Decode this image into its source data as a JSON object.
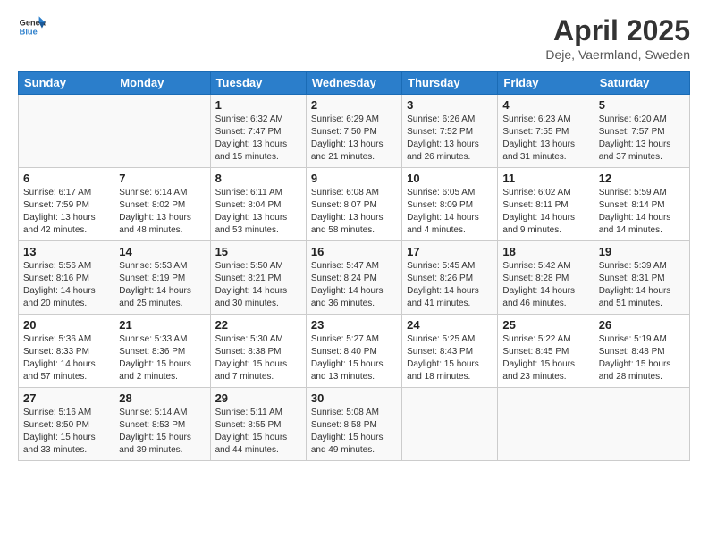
{
  "header": {
    "logo_line1": "General",
    "logo_line2": "Blue",
    "month_title": "April 2025",
    "location": "Deje, Vaermland, Sweden"
  },
  "weekdays": [
    "Sunday",
    "Monday",
    "Tuesday",
    "Wednesday",
    "Thursday",
    "Friday",
    "Saturday"
  ],
  "weeks": [
    [
      {
        "day": "",
        "info": ""
      },
      {
        "day": "",
        "info": ""
      },
      {
        "day": "1",
        "info": "Sunrise: 6:32 AM\nSunset: 7:47 PM\nDaylight: 13 hours and 15 minutes."
      },
      {
        "day": "2",
        "info": "Sunrise: 6:29 AM\nSunset: 7:50 PM\nDaylight: 13 hours and 21 minutes."
      },
      {
        "day": "3",
        "info": "Sunrise: 6:26 AM\nSunset: 7:52 PM\nDaylight: 13 hours and 26 minutes."
      },
      {
        "day": "4",
        "info": "Sunrise: 6:23 AM\nSunset: 7:55 PM\nDaylight: 13 hours and 31 minutes."
      },
      {
        "day": "5",
        "info": "Sunrise: 6:20 AM\nSunset: 7:57 PM\nDaylight: 13 hours and 37 minutes."
      }
    ],
    [
      {
        "day": "6",
        "info": "Sunrise: 6:17 AM\nSunset: 7:59 PM\nDaylight: 13 hours and 42 minutes."
      },
      {
        "day": "7",
        "info": "Sunrise: 6:14 AM\nSunset: 8:02 PM\nDaylight: 13 hours and 48 minutes."
      },
      {
        "day": "8",
        "info": "Sunrise: 6:11 AM\nSunset: 8:04 PM\nDaylight: 13 hours and 53 minutes."
      },
      {
        "day": "9",
        "info": "Sunrise: 6:08 AM\nSunset: 8:07 PM\nDaylight: 13 hours and 58 minutes."
      },
      {
        "day": "10",
        "info": "Sunrise: 6:05 AM\nSunset: 8:09 PM\nDaylight: 14 hours and 4 minutes."
      },
      {
        "day": "11",
        "info": "Sunrise: 6:02 AM\nSunset: 8:11 PM\nDaylight: 14 hours and 9 minutes."
      },
      {
        "day": "12",
        "info": "Sunrise: 5:59 AM\nSunset: 8:14 PM\nDaylight: 14 hours and 14 minutes."
      }
    ],
    [
      {
        "day": "13",
        "info": "Sunrise: 5:56 AM\nSunset: 8:16 PM\nDaylight: 14 hours and 20 minutes."
      },
      {
        "day": "14",
        "info": "Sunrise: 5:53 AM\nSunset: 8:19 PM\nDaylight: 14 hours and 25 minutes."
      },
      {
        "day": "15",
        "info": "Sunrise: 5:50 AM\nSunset: 8:21 PM\nDaylight: 14 hours and 30 minutes."
      },
      {
        "day": "16",
        "info": "Sunrise: 5:47 AM\nSunset: 8:24 PM\nDaylight: 14 hours and 36 minutes."
      },
      {
        "day": "17",
        "info": "Sunrise: 5:45 AM\nSunset: 8:26 PM\nDaylight: 14 hours and 41 minutes."
      },
      {
        "day": "18",
        "info": "Sunrise: 5:42 AM\nSunset: 8:28 PM\nDaylight: 14 hours and 46 minutes."
      },
      {
        "day": "19",
        "info": "Sunrise: 5:39 AM\nSunset: 8:31 PM\nDaylight: 14 hours and 51 minutes."
      }
    ],
    [
      {
        "day": "20",
        "info": "Sunrise: 5:36 AM\nSunset: 8:33 PM\nDaylight: 14 hours and 57 minutes."
      },
      {
        "day": "21",
        "info": "Sunrise: 5:33 AM\nSunset: 8:36 PM\nDaylight: 15 hours and 2 minutes."
      },
      {
        "day": "22",
        "info": "Sunrise: 5:30 AM\nSunset: 8:38 PM\nDaylight: 15 hours and 7 minutes."
      },
      {
        "day": "23",
        "info": "Sunrise: 5:27 AM\nSunset: 8:40 PM\nDaylight: 15 hours and 13 minutes."
      },
      {
        "day": "24",
        "info": "Sunrise: 5:25 AM\nSunset: 8:43 PM\nDaylight: 15 hours and 18 minutes."
      },
      {
        "day": "25",
        "info": "Sunrise: 5:22 AM\nSunset: 8:45 PM\nDaylight: 15 hours and 23 minutes."
      },
      {
        "day": "26",
        "info": "Sunrise: 5:19 AM\nSunset: 8:48 PM\nDaylight: 15 hours and 28 minutes."
      }
    ],
    [
      {
        "day": "27",
        "info": "Sunrise: 5:16 AM\nSunset: 8:50 PM\nDaylight: 15 hours and 33 minutes."
      },
      {
        "day": "28",
        "info": "Sunrise: 5:14 AM\nSunset: 8:53 PM\nDaylight: 15 hours and 39 minutes."
      },
      {
        "day": "29",
        "info": "Sunrise: 5:11 AM\nSunset: 8:55 PM\nDaylight: 15 hours and 44 minutes."
      },
      {
        "day": "30",
        "info": "Sunrise: 5:08 AM\nSunset: 8:58 PM\nDaylight: 15 hours and 49 minutes."
      },
      {
        "day": "",
        "info": ""
      },
      {
        "day": "",
        "info": ""
      },
      {
        "day": "",
        "info": ""
      }
    ]
  ]
}
